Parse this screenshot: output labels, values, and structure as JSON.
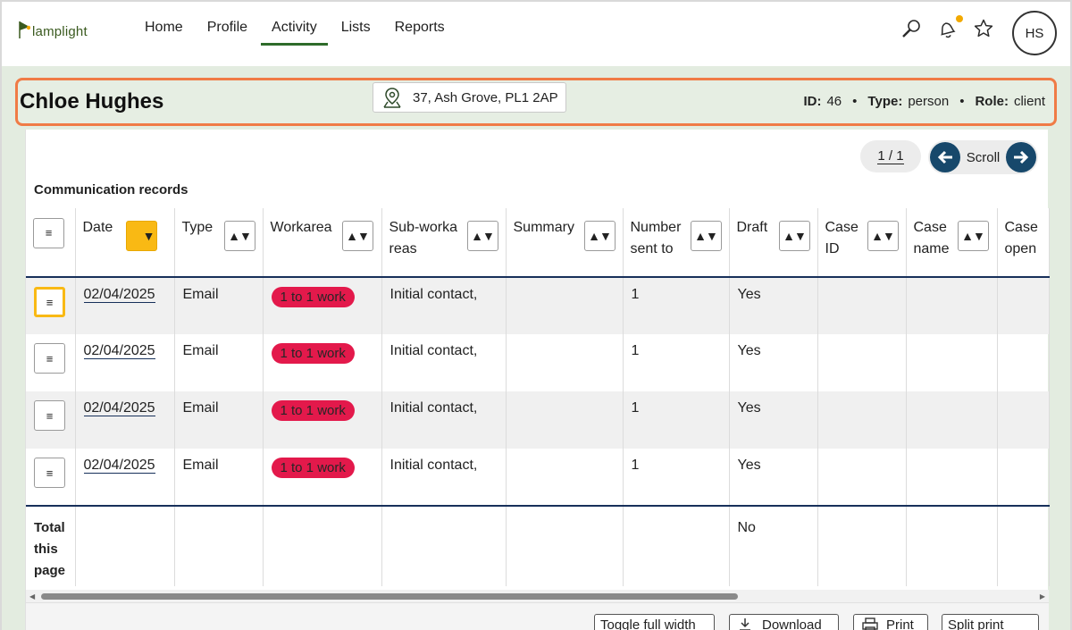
{
  "app": {
    "logo_text": "lamplight"
  },
  "nav": {
    "items": [
      {
        "label": "Home"
      },
      {
        "label": "Profile"
      },
      {
        "label": "Activity",
        "active": true
      },
      {
        "label": "Lists"
      },
      {
        "label": "Reports"
      }
    ]
  },
  "topbar": {
    "icons": [
      "search-icon",
      "bell-icon",
      "star-icon"
    ],
    "avatar_initials": "HS",
    "notification_color": "#f2a900"
  },
  "person": {
    "name": "Chloe Hughes",
    "address": "37, Ash Grove, PL1 2AP",
    "id_label": "ID:",
    "id_value": "46",
    "type_label": "Type:",
    "type_value": "person",
    "role_label": "Role:",
    "role_value": "client"
  },
  "table": {
    "pager": "1 / 1",
    "scroll_label": "Scroll",
    "title": "Communication records",
    "columns": [
      {
        "label": "Date"
      },
      {
        "label": "Type"
      },
      {
        "label": "Workarea"
      },
      {
        "label": "Sub-workareas"
      },
      {
        "label": "Summary"
      },
      {
        "label": "Number sent to"
      },
      {
        "label": "Draft"
      },
      {
        "label": "Case ID"
      },
      {
        "label": "Case name"
      },
      {
        "label": "Case open"
      }
    ],
    "rows": [
      {
        "date": "02/04/2025",
        "type": "Email",
        "workarea": "1 to 1 work",
        "subworkareas": "Initial contact,",
        "summary": "",
        "number_sent_to": "1",
        "draft": "Yes",
        "case_id": "",
        "case_name": "",
        "case_open": ""
      },
      {
        "date": "02/04/2025",
        "type": "Email",
        "workarea": "1 to 1 work",
        "subworkareas": "Initial contact,",
        "summary": "",
        "number_sent_to": "1",
        "draft": "Yes",
        "case_id": "",
        "case_name": "",
        "case_open": ""
      },
      {
        "date": "02/04/2025",
        "type": "Email",
        "workarea": "1 to 1 work",
        "subworkareas": "Initial contact,",
        "summary": "",
        "number_sent_to": "1",
        "draft": "Yes",
        "case_id": "",
        "case_name": "",
        "case_open": ""
      },
      {
        "date": "02/04/2025",
        "type": "Email",
        "workarea": "1 to 1 work",
        "subworkareas": "Initial contact,",
        "summary": "",
        "number_sent_to": "1",
        "draft": "Yes",
        "case_id": "",
        "case_name": "",
        "case_open": ""
      }
    ],
    "footer": {
      "label": "Total this page",
      "draft": "No"
    },
    "menu_glyph": "≡",
    "sort_glyph": "▲▼",
    "filter_glyph": "▼",
    "tag_color": "#e3194b",
    "filter_color": "#f9b914"
  },
  "actions": {
    "toggle_full_width": "Toggle full width",
    "download": "Download",
    "print": "Print",
    "split_print": "Split print"
  },
  "colors": {
    "accent": "#2e6b2a",
    "header_outline": "#f07b46",
    "navy": "#17486b"
  }
}
